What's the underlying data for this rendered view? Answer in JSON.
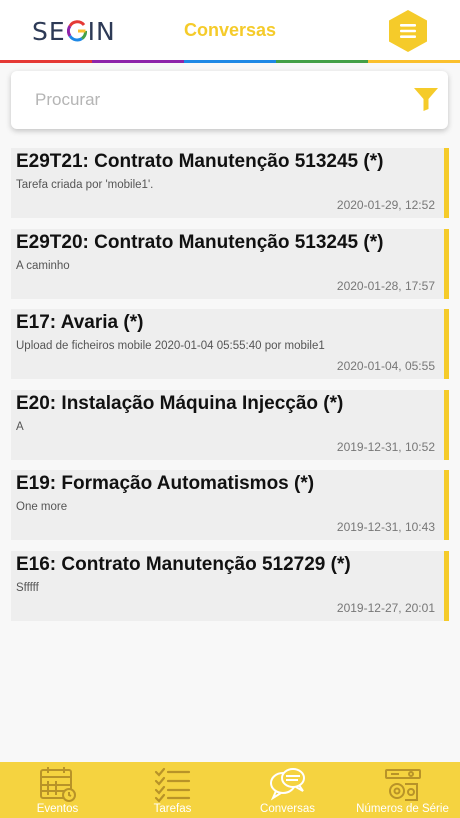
{
  "header": {
    "logo_left": "SE",
    "logo_right": "IN",
    "title": "Conversas",
    "rainbow": [
      "#e53935",
      "#8e24aa",
      "#1e88e5",
      "#43a047",
      "#fbc02d"
    ]
  },
  "search": {
    "placeholder": "Procurar",
    "icon": "filter-icon"
  },
  "conversations": [
    {
      "title": "E29T21: Contrato Manutenção 513245 (*)",
      "subtitle": "Tarefa criada por 'mobile1'.",
      "date": "2020-01-29, 12:52"
    },
    {
      "title": "E29T20: Contrato Manutenção 513245 (*)",
      "subtitle": "A caminho",
      "date": "2020-01-28, 17:57"
    },
    {
      "title": "E17: Avaria (*)",
      "subtitle": "Upload de ficheiros mobile 2020-01-04 05:55:40 por mobile1",
      "date": "2020-01-04, 05:55"
    },
    {
      "title": "E20: Instalação Máquina Injecção (*)",
      "subtitle": "A",
      "date": "2019-12-31, 10:52"
    },
    {
      "title": "E19: Formação Automatismos (*)",
      "subtitle": "One more",
      "date": "2019-12-31, 10:43"
    },
    {
      "title": "E16: Contrato Manutenção 512729 (*)",
      "subtitle": "Sfffff",
      "date": "2019-12-27, 20:01"
    }
  ],
  "tabs": [
    {
      "label": "Eventos",
      "icon": "calendar-icon"
    },
    {
      "label": "Tarefas",
      "icon": "checklist-icon"
    },
    {
      "label": "Conversas",
      "icon": "chat-icon"
    },
    {
      "label": "Números de Série",
      "icon": "machine-icon"
    }
  ],
  "colors": {
    "accent": "#f5cb2a",
    "tabbar": "#f5d340",
    "logo": "#2d3a56"
  }
}
